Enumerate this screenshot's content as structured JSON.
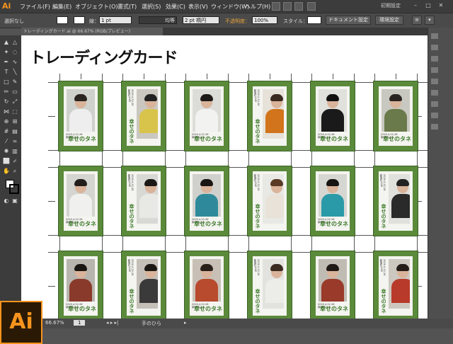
{
  "app": {
    "logo": "Ai",
    "big_logo": "Ai"
  },
  "menu": [
    "ファイル(F)",
    "編集(E)",
    "オブジェクト(O)",
    "書式(T)",
    "選択(S)",
    "効果(C)",
    "表示(V)",
    "ウィンドウ(W)",
    "ヘルプ(H)"
  ],
  "workspace": "初期設定",
  "control": {
    "selection": "選択なし",
    "stroke_label": "線：",
    "stroke_value": "1 pt",
    "profile": "均等",
    "brush": "2 pt 楕円",
    "opacity_label": "不透明度：",
    "opacity_value": "100%",
    "style_label": "スタイル：",
    "doc_setup": "ドキュメント設定",
    "prefs": "環境設定"
  },
  "document": {
    "tab": "トレーディングカード.ai @ 66.67% (RGB/プレビュー)"
  },
  "artboard": {
    "title": "トレーディングカード"
  },
  "card_common": {
    "date": "2020.4.22-26",
    "venue": "新宿村LIVE",
    "brand": "幸せのタネ"
  },
  "cards": [
    {
      "row": 0,
      "col": 0,
      "rotated": false,
      "shirt": "#eeeeee",
      "hair": "#2a2520",
      "bg": "#cfd1cc"
    },
    {
      "row": 0,
      "col": 1,
      "rotated": true,
      "shirt": "#d8c44a",
      "hair": "#222",
      "bg": "#c9c7bf"
    },
    {
      "row": 0,
      "col": 2,
      "rotated": false,
      "shirt": "#f2f2f0",
      "hair": "#1e1a18",
      "bg": "#dcdcd8"
    },
    {
      "row": 0,
      "col": 3,
      "rotated": true,
      "shirt": "#d2741c",
      "hair": "#3a2a20",
      "bg": "#e6e2da"
    },
    {
      "row": 0,
      "col": 4,
      "rotated": false,
      "shirt": "#1a1a1a",
      "hair": "#111",
      "bg": "#e0e0dc"
    },
    {
      "row": 0,
      "col": 5,
      "rotated": false,
      "shirt": "#6b7a4a",
      "hair": "#2a2420",
      "bg": "#c8c8c0"
    },
    {
      "row": 1,
      "col": 0,
      "rotated": false,
      "shirt": "#f0f0ee",
      "hair": "#241e1a",
      "bg": "#d4d4d0"
    },
    {
      "row": 1,
      "col": 1,
      "rotated": true,
      "shirt": "#e8e8e4",
      "hair": "#1c1816",
      "bg": "#d8d8d4"
    },
    {
      "row": 1,
      "col": 2,
      "rotated": false,
      "shirt": "#2e8a9a",
      "hair": "#1a1614",
      "bg": "#d0d0cc"
    },
    {
      "row": 1,
      "col": 3,
      "rotated": true,
      "shirt": "#e8e2d8",
      "hair": "#5a3a24",
      "bg": "#e8e8e4"
    },
    {
      "row": 1,
      "col": 4,
      "rotated": false,
      "shirt": "#2a9aa8",
      "hair": "#181412",
      "bg": "#d6d6d2"
    },
    {
      "row": 1,
      "col": 5,
      "rotated": true,
      "shirt": "#2a2a2a",
      "hair": "#222",
      "bg": "#e0e0dc"
    },
    {
      "row": 2,
      "col": 0,
      "rotated": false,
      "shirt": "#8a3a2a",
      "hair": "#1a1612",
      "bg": "#b8b4ae"
    },
    {
      "row": 2,
      "col": 1,
      "rotated": true,
      "shirt": "#3a3a3a",
      "hair": "#1c1814",
      "bg": "#c4c0b8"
    },
    {
      "row": 2,
      "col": 2,
      "rotated": false,
      "shirt": "#b84a2e",
      "hair": "#2a201a",
      "bg": "#c8c0b6"
    },
    {
      "row": 2,
      "col": 3,
      "rotated": true,
      "shirt": "#ecece8",
      "hair": "#3a2a20",
      "bg": "#e2e2de"
    },
    {
      "row": 2,
      "col": 4,
      "rotated": false,
      "shirt": "#9a3a2a",
      "hair": "#201a16",
      "bg": "#c0bcb4"
    },
    {
      "row": 2,
      "col": 5,
      "rotated": true,
      "shirt": "#b83a2a",
      "hair": "#241c18",
      "bg": "#ccc8c0"
    }
  ],
  "status": {
    "zoom": "66.67%",
    "artboard_no": "1",
    "tool": "手のひら"
  },
  "colors": {
    "card_green": "#5a8a3a",
    "accent": "#f7941d"
  }
}
